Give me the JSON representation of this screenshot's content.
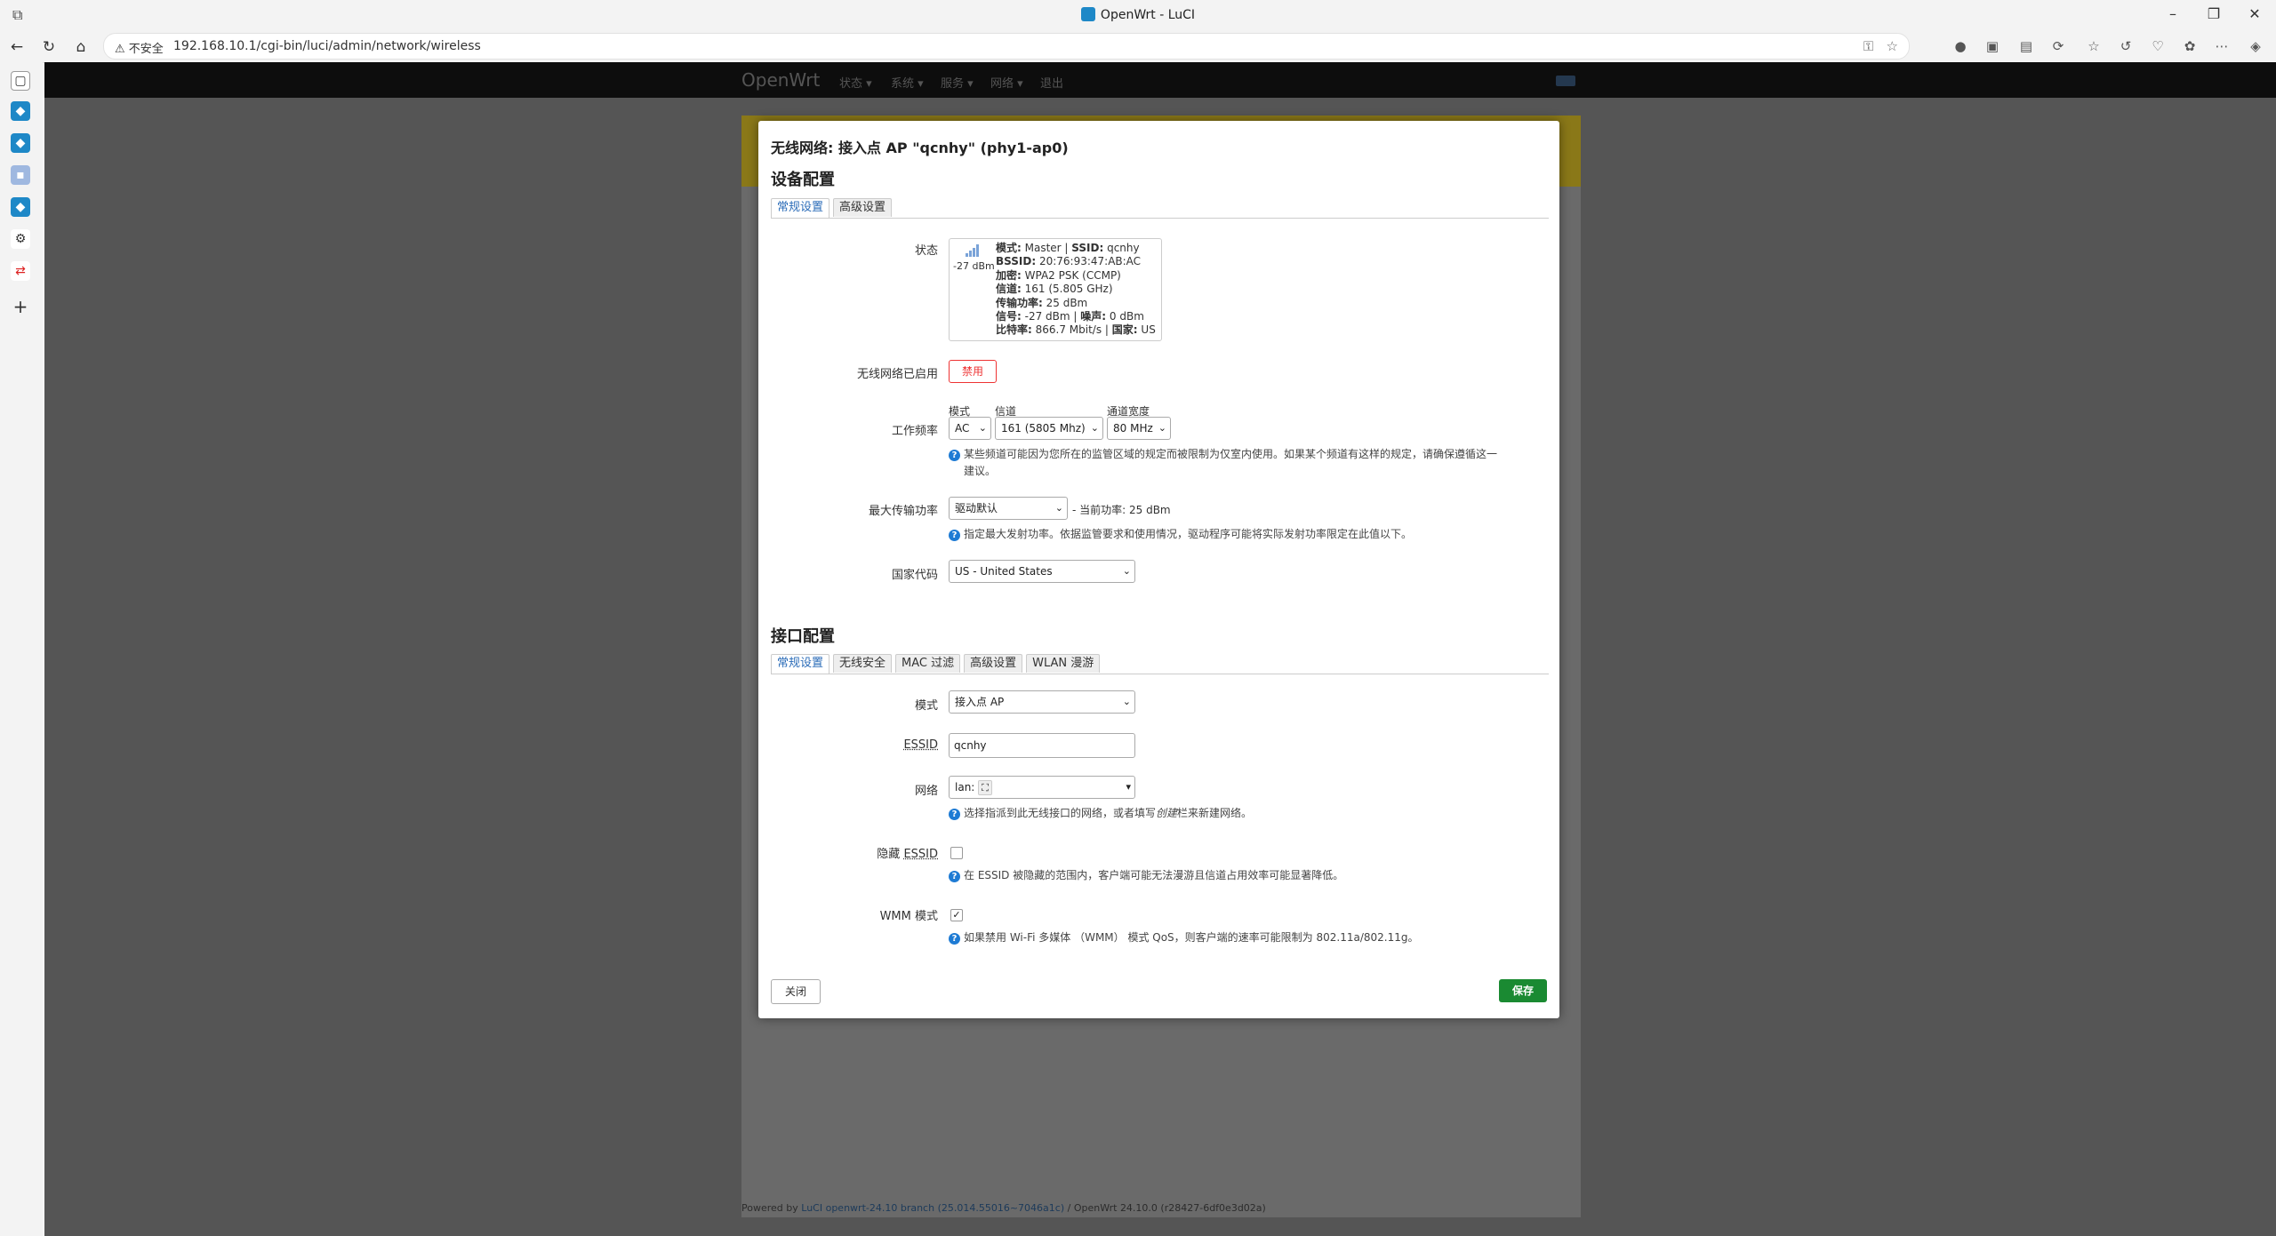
{
  "browser": {
    "tab_title": "OpenWrt - LuCI",
    "security_label": "不安全",
    "url": "192.168.10.1/cgi-bin/luci/admin/network/wireless"
  },
  "nav": {
    "brand": "OpenWrt",
    "menu": [
      "状态 ▾",
      "系统 ▾",
      "服务 ▾",
      "网络 ▾",
      "退出"
    ]
  },
  "footer": {
    "prefix": "Powered by",
    "luci": "LuCI openwrt-24.10 branch (25.014.55016~7046a1c)",
    "sep": " / ",
    "openwrt": "OpenWrt 24.10.0 (r28427-6df0e3d02a)"
  },
  "modal": {
    "title": "无线网络: 接入点 AP \"qcnhy\" (phy1-ap0)",
    "device_section": "设备配置",
    "device_tabs": [
      "常规设置",
      "高级设置"
    ],
    "status": {
      "label": "状态",
      "dbm": "-27 dBm",
      "lines": [
        {
          "k": "模式:",
          "v": " Master | ",
          "k2": "SSID:",
          "v2": " qcnhy"
        },
        {
          "k": "BSSID:",
          "v": " 20:76:93:47:AB:AC",
          "k2": "",
          "v2": ""
        },
        {
          "k": "加密:",
          "v": " WPA2 PSK (CCMP)",
          "k2": "",
          "v2": ""
        },
        {
          "k": "信道:",
          "v": " 161 (5.805 GHz)",
          "k2": "",
          "v2": ""
        },
        {
          "k": "传输功率:",
          "v": " 25 dBm",
          "k2": "",
          "v2": ""
        },
        {
          "k": "信号:",
          "v": " -27 dBm | ",
          "k2": "噪声:",
          "v2": " 0 dBm"
        },
        {
          "k": "比特率:",
          "v": " 866.7 Mbit/s | ",
          "k2": "国家:",
          "v2": " US"
        }
      ]
    },
    "enabled_label": "无线网络已启用",
    "disable_button": "禁用",
    "freq": {
      "label": "工作频率",
      "mode_label": "模式",
      "channel_label": "信道",
      "width_label": "通道宽度",
      "mode_value": "AC",
      "channel_value": "161 (5805 Mhz)",
      "width_value": "80 MHz",
      "hint_line1": "某些频道可能因为您所在的监管区域的规定而被限制为仅室内使用。如果某个频道有这样的规定，请确保遵循这一",
      "hint_line2": "建议。"
    },
    "txpower": {
      "label": "最大传输功率",
      "value": "驱动默认",
      "current": "- 当前功率: 25 dBm",
      "hint": "指定最大发射功率。依据监管要求和使用情况，驱动程序可能将实际发射功率限定在此值以下。"
    },
    "country": {
      "label": "国家代码",
      "value": "US - United States"
    },
    "iface_section": "接口配置",
    "iface_tabs": [
      "常规设置",
      "无线安全",
      "MAC 过滤",
      "高级设置",
      "WLAN 漫游"
    ],
    "mode": {
      "label": "模式",
      "value": "接入点 AP"
    },
    "essid": {
      "label": "ESSID",
      "value": "qcnhy"
    },
    "network": {
      "label": "网络",
      "value": "lan:",
      "hint": "选择指派到此无线接口的网络，或者填写",
      "hint_em": "创建",
      "hint_tail": "栏来新建网络。"
    },
    "hidden": {
      "label_prefix": "隐藏 ",
      "label_abbr": "ESSID",
      "hint": "在 ESSID 被隐藏的范围内，客户端可能无法漫游且信道占用效率可能显著降低。"
    },
    "wmm": {
      "label": "WMM 模式",
      "checked_mark": "✓",
      "hint": "如果禁用 Wi-Fi 多媒体 （WMM） 模式 QoS，则客户端的速率可能限制为 802.11a/802.11g。"
    },
    "close_button": "关闭",
    "save_button": "保存"
  },
  "colors": {
    "accent": "#2b6cb8",
    "danger": "#e33333",
    "save": "#1a8a32"
  }
}
